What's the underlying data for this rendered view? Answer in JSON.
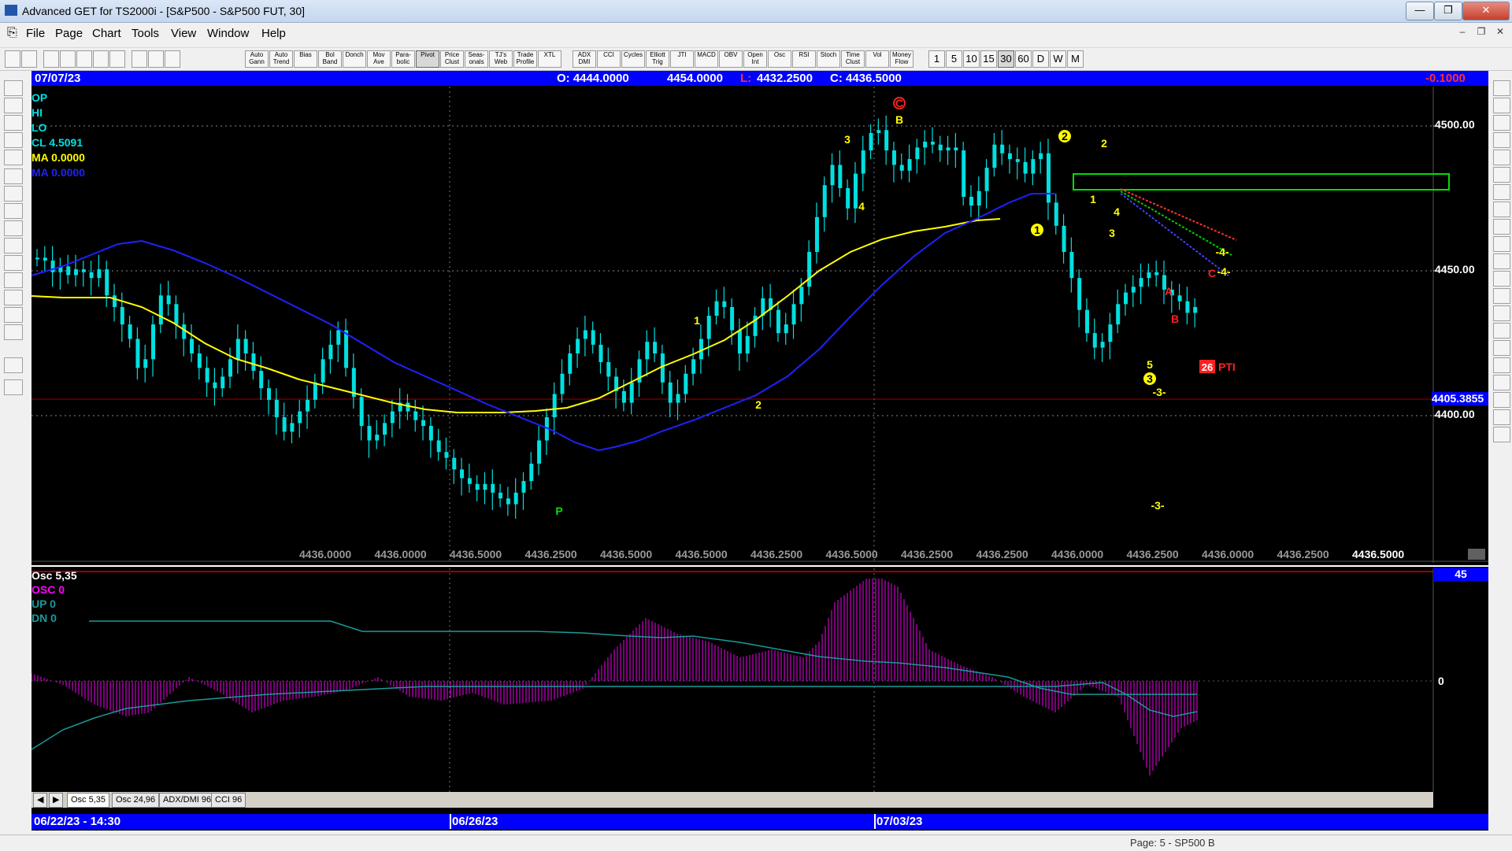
{
  "window": {
    "title": "Advanced GET for TS2000i - [S&P500 - S&P500 FUT, 30]",
    "buttons": [
      "—",
      "❐",
      "✕"
    ],
    "mdi_buttons": [
      "–",
      "❐",
      "✕"
    ]
  },
  "menu": [
    "File",
    "Page",
    "Chart",
    "Tools",
    "View",
    "Window",
    "Help"
  ],
  "toolbar": {
    "studies": [
      "Auto\nGann",
      "Auto\nTrend",
      "Bias",
      "Bol\nBand",
      "Donch",
      "Mov\nAve",
      "Para-\nbolic",
      "Pivot",
      "Price\nClust",
      "Seas-\nonals",
      "TJ's\nWeb",
      "Trade\nProfile",
      "XTL",
      "ADX\nDMI",
      "CCI",
      "Cycles",
      "Elliott\nTrig",
      "JTI",
      "MACD",
      "OBV",
      "Open\nInt",
      "Osc",
      "RSI",
      "Stoch",
      "Time\nClust",
      "Vol",
      "Money\nFlow"
    ],
    "intervals": [
      "1",
      "5",
      "10",
      "15",
      "30",
      "60",
      "D",
      "W",
      "M"
    ],
    "active_interval": "30"
  },
  "header": {
    "date": "07/07/23",
    "open": "O: 4444.0000",
    "high": "4454.0000",
    "low_label": "L:",
    "low": "4432.2500",
    "close": "C: 4436.5000",
    "change": "-0.1000"
  },
  "legend": {
    "op": "OP",
    "hi": "HI",
    "lo": "LO",
    "cl": "CL  4.5091",
    "ma_yellow": "MA  0.0000",
    "ma_blue": "MA  0.0000"
  },
  "price_axis": {
    "labels": [
      "4500.00",
      "4450.00",
      "4400.00"
    ],
    "current_price": "4405.3855"
  },
  "bottom_values": [
    "4436.0000",
    "4436.0000",
    "4436.5000",
    "4436.2500",
    "4436.5000",
    "4436.5000",
    "4436.2500",
    "4436.5000",
    "4436.2500",
    "4436.2500",
    "4436.0000",
    "4436.2500",
    "4436.0000",
    "4436.2500",
    "4436.5000"
  ],
  "wave_labels": {
    "c_top": "C",
    "b_top": "B",
    "w3": "3",
    "w4": "4",
    "w1_mid": "1",
    "w2_mid": "2",
    "p_low": "P",
    "w2_circ": "2",
    "w2_small": "2",
    "w1_small": "1",
    "w1_circ": "1",
    "w4_small": "4",
    "w3_small": "3",
    "w5_small": "5",
    "w3_circ": "3",
    "w3_dash": "-3-",
    "w3_dash_low": "-3-",
    "a_red": "A",
    "b_red": "B",
    "c_red": "C",
    "w4_a": "-4-",
    "w4_b": "-4-",
    "pti_num": "26",
    "pti_label": "PTI"
  },
  "oscillator": {
    "title": "Osc 5,35",
    "osc": "OSC 0",
    "up": "UP   0",
    "dn": "DN   0",
    "scale_top": "45",
    "zero": "0"
  },
  "tabs": [
    "Osc 5,35",
    "Osc 24,96",
    "ADX/DMI 96",
    "CCI 96"
  ],
  "dates": {
    "start": "06/22/23 - 14:30",
    "mid1": "06/26/23",
    "mid2": "07/03/23"
  },
  "status": {
    "page": "Page: 5 - SP500 B"
  },
  "chart_data": {
    "type": "candlestick",
    "symbol": "S&P500 FUT",
    "interval": "30",
    "ylim": [
      4360,
      4512
    ],
    "closes": [
      4453,
      4452,
      4448,
      4450,
      4447,
      4449,
      4448,
      4446,
      4449,
      4440,
      4436,
      4430,
      4425,
      4415,
      4418,
      4430,
      4440,
      4437,
      4430,
      4425,
      4420,
      4415,
      4410,
      4408,
      4412,
      4418,
      4425,
      4420,
      4414,
      4408,
      4404,
      4398,
      4393,
      4396,
      4400,
      4404,
      4410,
      4418,
      4423,
      4428,
      4415,
      4405,
      4395,
      4390,
      4392,
      4396,
      4400,
      4403,
      4400,
      4397,
      4395,
      4390,
      4386,
      4384,
      4380,
      4377,
      4375,
      4373,
      4375,
      4372,
      4370,
      4368,
      4372,
      4376,
      4382,
      4390,
      4398,
      4406,
      4413,
      4420,
      4425,
      4428,
      4423,
      4417,
      4412,
      4407,
      4403,
      4410,
      4418,
      4424,
      4420,
      4410,
      4403,
      4406,
      4413,
      4418,
      4425,
      4433,
      4438,
      4436,
      4428,
      4420,
      4426,
      4433,
      4439,
      4435,
      4427,
      4430,
      4437,
      4443,
      4455,
      4467,
      4478,
      4485,
      4477,
      4470,
      4482,
      4490,
      4496,
      4497,
      4490,
      4485,
      4483,
      4487,
      4491,
      4493,
      4492,
      4490,
      4491,
      4490,
      4474,
      4471,
      4476,
      4484,
      4492,
      4489,
      4487,
      4486,
      4482,
      4487,
      4489,
      4472,
      4464,
      4455,
      4446,
      4435,
      4427,
      4422,
      4424,
      4430,
      4437,
      4441,
      4443,
      4446,
      4448,
      4447,
      4442,
      4440,
      4438,
      4434,
      4436
    ]
  }
}
